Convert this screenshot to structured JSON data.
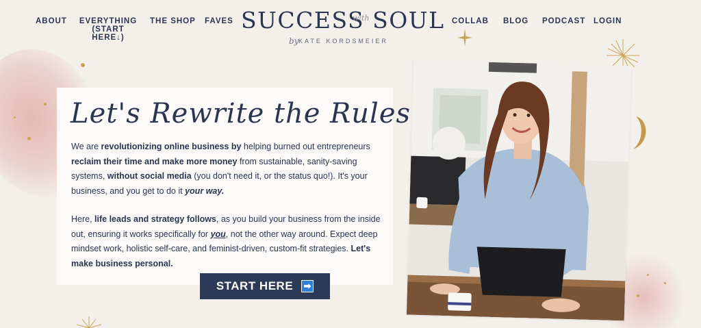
{
  "nav": {
    "about": "ABOUT",
    "everything_line1": "EVERYTHING",
    "everything_line2": "(START HERE↓)",
    "shop": "THE SHOP",
    "faves": "FAVES",
    "collab": "COLLAB",
    "blog": "BLOG",
    "podcast": "PODCAST",
    "login": "LOGIN"
  },
  "logo": {
    "main": "SUCCESS SOUL",
    "with": "with",
    "by": "by",
    "author": "KATE KORDSMEIER"
  },
  "hero": {
    "headline": "Let's Rewrite the Rules!",
    "p1": {
      "t1": "We are ",
      "b1": "revolutionizing online business by",
      "t2": " helping burned out entrepreneurs ",
      "b2": "reclaim their time and make more money",
      "t3": " from sustainable, sanity-saving systems, ",
      "b3": "without social media",
      "t4": " (you don't need it, or the status quo!). It's your business, and you get to do it ",
      "i1": "your way."
    },
    "p2": {
      "t1": "Here, ",
      "b1": "life leads and strategy follows",
      "t2": ", as you build your business from the inside out, ensuring it works specifically for ",
      "u1": "you",
      "t3": ", not the other way around. Expect deep mindset work, holistic self-care, and feminist-driven, custom-fit strategies. ",
      "b2": "Let's make business personal."
    },
    "cta_label": "START HERE",
    "cta_icon": "arrow-right-icon"
  },
  "colors": {
    "background": "#f3efea",
    "navy": "#2b3550",
    "button": "#2d3a57",
    "gold": "#c9a456",
    "blush": "#e2b0ab"
  }
}
